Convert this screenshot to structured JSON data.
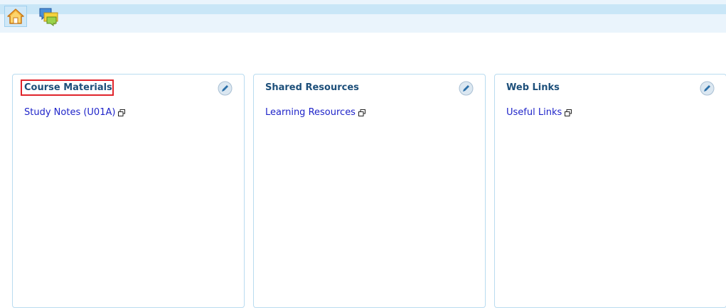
{
  "toolbar": {
    "home_icon": "home-icon",
    "chat_icon": "chat-bubbles-icon"
  },
  "panels": [
    {
      "title": "Course Materials",
      "highlighted": true,
      "edit_icon": "pencil-icon",
      "links": [
        {
          "label": "Study Notes (U01A)",
          "icon": "external-window-icon"
        }
      ]
    },
    {
      "title": "Shared Resources",
      "highlighted": false,
      "edit_icon": "pencil-icon",
      "links": [
        {
          "label": "Learning Resources",
          "icon": "external-window-icon"
        }
      ]
    },
    {
      "title": "Web Links",
      "highlighted": false,
      "edit_icon": "pencil-icon",
      "links": [
        {
          "label": "Useful Links",
          "icon": "external-window-icon"
        }
      ]
    }
  ],
  "colors": {
    "title": "#1d4f7a",
    "link": "#1f24c9",
    "highlight": "#e0242b",
    "panel_border": "#b9dcf0"
  }
}
